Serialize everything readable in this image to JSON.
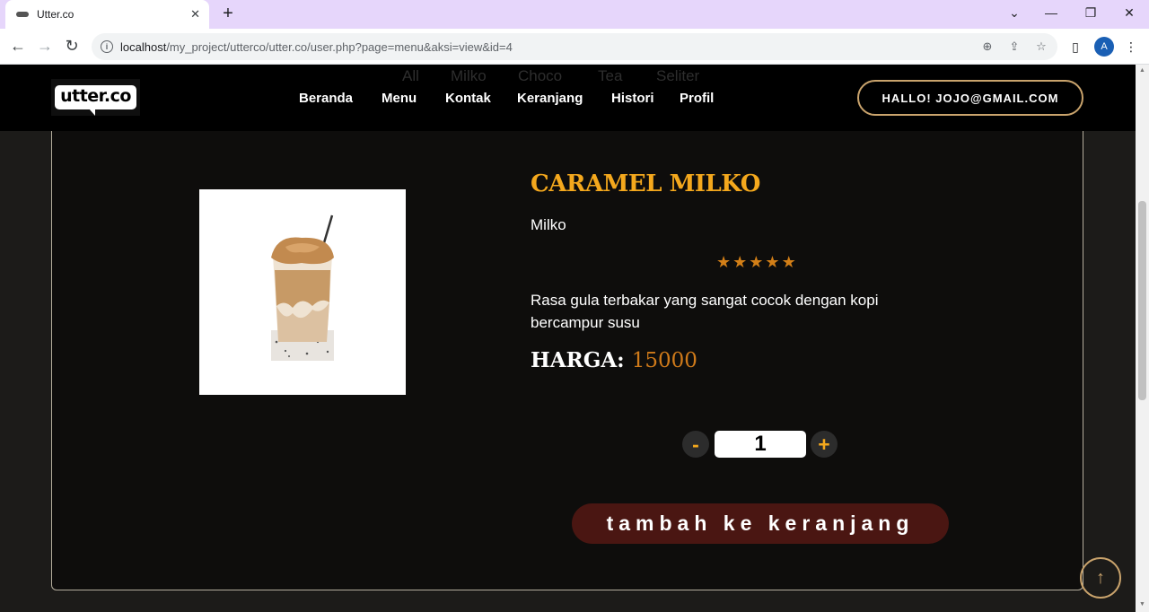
{
  "browser": {
    "tab_title": "Utter.co",
    "tab_close": "✕",
    "new_tab": "+",
    "url_host": "localhost",
    "url_path": "/my_project/utterco/utter.co/user.php?page=menu&aksi=view&id=4",
    "profile_initial": "A",
    "window_controls": {
      "chevron": "⌄",
      "minimize": "—",
      "restore": "❐",
      "close": "✕"
    }
  },
  "site": {
    "logo_text": "utter.co",
    "subnav": [
      "All",
      "Milko",
      "Choco",
      "Tea",
      "Seliter"
    ],
    "nav": [
      "Beranda",
      "Menu",
      "Kontak",
      "Keranjang",
      "Histori",
      "Profil"
    ],
    "greeting": "HALLO! JOJO@GMAIL.COM"
  },
  "product": {
    "name": "CARAMEL MILKO",
    "category": "Milko",
    "rating": 5,
    "rating_max": 5,
    "description": "Rasa gula terbakar yang sangat cocok dengan kopi bercampur susu",
    "price_label": "HARGA:",
    "price": "15000",
    "quantity": "1",
    "minus_label": "-",
    "plus_label": "+",
    "add_to_cart": "tambah ke keranjang"
  },
  "colors": {
    "accent": "#f4a81d",
    "price": "#cf7a1a",
    "star": "#d37f17",
    "button_bg": "#4a1612",
    "border_gold": "#c9a36c"
  }
}
